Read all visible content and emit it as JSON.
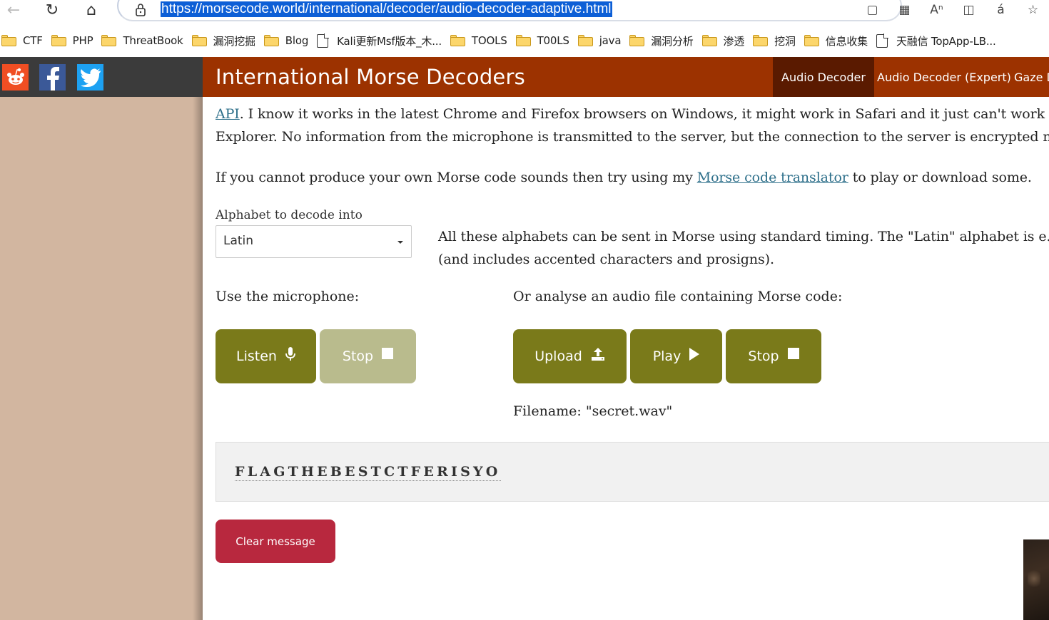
{
  "browser": {
    "url": "https://morsecode.world/international/decoder/audio-decoder-adaptive.html"
  },
  "bookmarks": [
    {
      "label": "CTF",
      "type": "folder"
    },
    {
      "label": "PHP",
      "type": "folder"
    },
    {
      "label": "ThreatBook",
      "type": "folder"
    },
    {
      "label": "漏洞挖掘",
      "type": "folder"
    },
    {
      "label": "Blog",
      "type": "folder"
    },
    {
      "label": "Kali更新Msf版本_木...",
      "type": "page"
    },
    {
      "label": "TOOLS",
      "type": "folder"
    },
    {
      "label": "T00LS",
      "type": "folder"
    },
    {
      "label": "java",
      "type": "folder"
    },
    {
      "label": "漏洞分析",
      "type": "folder"
    },
    {
      "label": "渗透",
      "type": "folder"
    },
    {
      "label": "挖洞",
      "type": "folder"
    },
    {
      "label": "信息收集",
      "type": "folder"
    },
    {
      "label": "天融信 TopApp-LB...",
      "type": "page"
    }
  ],
  "header": {
    "title": "International Morse Decoders",
    "nav": [
      "Audio Decoder",
      "Audio Decoder (Expert)",
      "Gaze D"
    ]
  },
  "content": {
    "para1_link": "API",
    "para1_rest": ". I know it works in the latest Chrome and Firefox browsers on Windows, it might work in Safari and it just can't work in Internet",
    "para1_line2": "Explorer. No information from the microphone is transmitted to the server, but the connection to the server is encrypted nonetheless.",
    "para2_before": "If you cannot produce your own Morse code sounds then try using my ",
    "para2_link": "Morse code translator",
    "para2_after": " to play or download some.",
    "alphabet_label": "Alphabet to decode into",
    "alphabet_value": "Latin",
    "alphabet_note_line1": "All these alphabets can be sent in Morse using standard timing. The \"Latin\" alphabet is e.g. \"ABC\"",
    "alphabet_note_line2": "(and includes accented characters and prosigns).",
    "mic_label": "Use the microphone:",
    "file_label": "Or analyse an audio file containing Morse code:",
    "buttons": {
      "listen": "Listen",
      "stop_mic": "Stop",
      "upload": "Upload",
      "play": "Play",
      "stop_file": "Stop"
    },
    "filename": "Filename: \"secret.wav\"",
    "decoded": "FLAGTHEBESTCTFERISYO",
    "clear": "Clear message"
  },
  "colors": {
    "header": "#9c3200",
    "nav_active": "#5a1a00",
    "button": "#7a7a1a",
    "button_disabled": "#b9bb8d",
    "clear_button": "#b8283e",
    "sidebar": "#d2b6a0",
    "link": "#2d6f8a"
  }
}
